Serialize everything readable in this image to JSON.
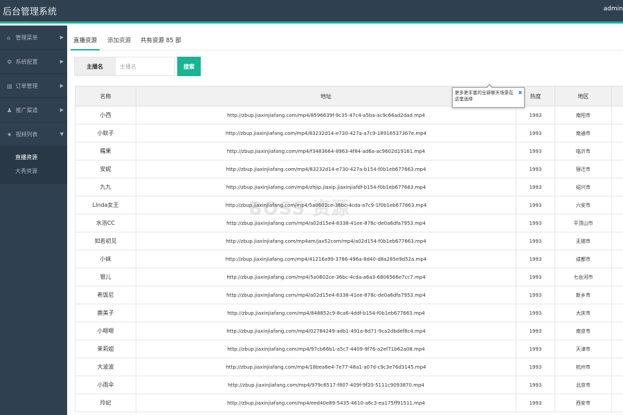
{
  "header": {
    "title": "后台管理系统",
    "user": "admin"
  },
  "sidebar": {
    "items": [
      {
        "icon": "home-icon",
        "glyph": "⌂",
        "label": "管理菜单"
      },
      {
        "icon": "gears-icon",
        "glyph": "⚙",
        "label": "系统配置"
      },
      {
        "icon": "bar-chart-icon",
        "glyph": "▥",
        "label": "订单管理"
      },
      {
        "icon": "user-icon",
        "glyph": "♟",
        "label": "推广渠道"
      },
      {
        "icon": "star-icon",
        "glyph": "★",
        "label": "视频列表"
      }
    ],
    "subitems": [
      {
        "label": "直播资源",
        "active": true
      },
      {
        "label": "大秀资源",
        "active": false
      }
    ]
  },
  "tabs": {
    "live": "直播资源",
    "add": "添加资源",
    "total": "共有资源 85 部"
  },
  "search": {
    "label": "主播名",
    "placeholder": "主播名",
    "button": "搜索"
  },
  "tooltip": {
    "text": "更多更丰富的全新聊天场景在这里选择",
    "close": "x"
  },
  "watermark": "BOSS 资源",
  "table": {
    "headers": [
      "名称",
      "地址",
      "热度",
      "地区"
    ],
    "rows": [
      [
        "小西",
        "http://zbup.jiaxinjiafang.com/mp4/8596639f-9c35-47c4-a5ba-ac9c66ad2dad.mp4",
        "1993",
        "南阳市"
      ],
      [
        "小蚊子",
        "http://zbup.jiaxinjiafang.com/mp4/83232d14-e730-427a-a7c9-18916537367e.mp4",
        "1993",
        "南通市"
      ],
      [
        "糯果",
        "http://zbup.jiaxinjiafang.com/mp4/f3483664-8963-4f84-ad6a-ac9602d19161.mp4",
        "1993",
        "临沂市"
      ],
      [
        "安妮",
        "http://zbup.jiaxinjiafang.com/mp4/83232d14-e730-427a-b154-f0b1eb677663.mp4",
        "1993",
        "宿迁市"
      ],
      [
        "九九",
        "http://zbup.jiaxinjiafang.com/mp4/zhjip.jiaxip.jiaxinjiafdf-b154-f0b1eb677663.mp4",
        "1993",
        "绍兴市"
      ],
      [
        "LInda女王",
        "http://zbup.jiaxinjiafang.com/mp4/5a0602ce-36bc-4cda-a7c9-1f0b1eb677663.mp4",
        "1993",
        "六安市"
      ],
      [
        "水浴CC",
        "http://zbup.jiaxinjiafang.com/mp4/a02d15e4-8338-41ee-878c-de0a6dfa7953.mp4",
        "1993",
        "平顶山市"
      ],
      [
        "如若初见",
        "http://zbup.jiaxinjiafang.com/mp4am/jax52com/mp4/a02d154-f0b1eb677663.mp4",
        "1993",
        "无锡市"
      ],
      [
        "小妹",
        "http://zbup.jiaxinjiafang.com/mp4/41216a99-3786-496a-8d40-d8a285e9d52a.mp4",
        "1993",
        "成都市"
      ],
      [
        "银儿",
        "http://zbup.jiaxinjiafang.com/mp4/5a0602ce-36bc-4cda-a6a3-6806566e7cc7.mp4",
        "1993",
        "七台河市"
      ],
      [
        "希饭尼",
        "http://zbup.jiaxinjiafang.com/mp4/a02d15e4-8338-41ee-878c-de0a6dfa7953.mp4",
        "1993",
        "新乡市"
      ],
      [
        "鹿美子",
        "http://zbup.jiaxinjiafang.com/mp4/848852c9-8ca6-4ddf-b154-f0b1eb677663.mp4",
        "1993",
        "大庆市"
      ],
      [
        "小嗯嗯",
        "http://zbup.jiaxinjiafang.com/mp4/02784249-adb1-491a-8d71-9ca2dbdef8c4.mp4",
        "1993",
        "南京市"
      ],
      [
        "茉莉姐",
        "http://zbup.jiaxinjiafang.com/mp4/97cb66b1-a5c7-4409-9f76-a2ef71b62a08.mp4",
        "1993",
        "天津市"
      ],
      [
        "大波波",
        "http://zbup.jiaxinjiafang.com/mp4/18bea6e4-7e77-48a1-a07d-c9c3e76d3145.mp4",
        "1993",
        "杭州市"
      ],
      [
        "小雨伞",
        "http://zbup.jiaxinjiafang.com/mp4/979c6517-f807-409f-9f20-5111c9093870.mp4",
        "1993",
        "北京市"
      ],
      [
        "玲妃",
        "http://zbup.jiaxinjiafang.com/mp4/eed40e89-5435-4610-a6c3-ea175ff91511.mp4",
        "1993",
        "西安市"
      ]
    ]
  }
}
